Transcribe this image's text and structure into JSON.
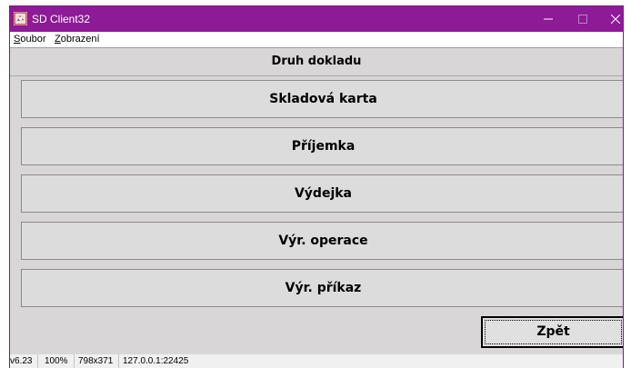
{
  "window": {
    "title": "SD Client32",
    "icon": "app-icon",
    "controls": {
      "minimize": "minimize-icon",
      "maximize": "maximize-icon",
      "close": "close-icon"
    }
  },
  "menu": {
    "items": [
      {
        "accel": "S",
        "rest": "oubor"
      },
      {
        "accel": "Z",
        "rest": "obrazení"
      }
    ]
  },
  "main": {
    "heading": "Druh dokladu",
    "buttons": [
      "Skladová karta",
      "Příjemka",
      "Výdejka",
      "Výr. operace",
      "Výr. příkaz"
    ],
    "back_label": "Zpět"
  },
  "status": {
    "version": "v6.23",
    "zoom": "100%",
    "size": "798x371",
    "address": "127.0.0.1:22425"
  },
  "colors": {
    "titlebar": "#8d1a96",
    "client": "#d9d6d7"
  }
}
